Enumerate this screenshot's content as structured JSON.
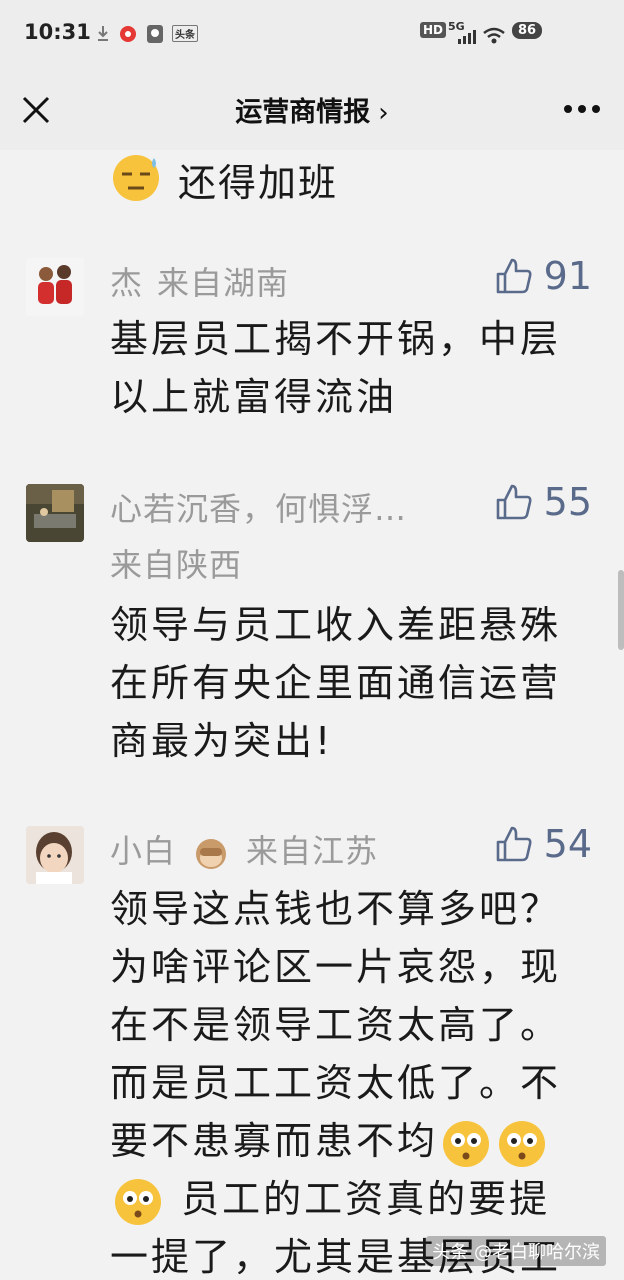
{
  "status_bar": {
    "time": "10:31",
    "network_label": "5G",
    "hd_label": "HD",
    "battery": "86",
    "notif_label": "头条"
  },
  "nav": {
    "title": "运营商情报",
    "chevron": "›"
  },
  "top_comment_tail": "还得加班",
  "comments": [
    {
      "user": "杰",
      "location": "来自湖南",
      "likes": "91",
      "text": "基层员工揭不开锅，中层以上就富得流油"
    },
    {
      "user": "心若沉香，何惧浮…",
      "location": "来自陕西",
      "likes": "55",
      "text": "领导与员工收入差距悬殊在所有央企里面通信运营商最为突出!"
    },
    {
      "user": "小白",
      "location": "来自江苏",
      "likes": "54",
      "text_lines": [
        "领导这点钱也不算多吧？",
        "为啥评论区一片哀怨，现",
        "在不是领导工资太高了。",
        "而是员工工资太低了。不",
        "要不患寡而患不均",
        "员工的工资真的要提",
        "一提了，尤其是基层员工"
      ]
    }
  ],
  "watermark": "头条 @老白聊哈尔滨",
  "colors": {
    "background": "#f2f2f2",
    "meta_text": "#9a9a9a",
    "like_icon": "#5a6a8a"
  }
}
